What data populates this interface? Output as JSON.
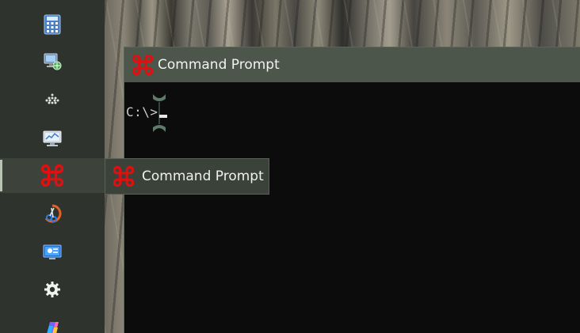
{
  "taskbar": {
    "items": [
      {
        "icon": "calculator-icon"
      },
      {
        "icon": "network-computer-icon"
      },
      {
        "icon": "dots-grid-icon"
      },
      {
        "icon": "performance-monitor-icon"
      },
      {
        "icon": "command-prompt-icon",
        "active": true
      },
      {
        "icon": "snipping-tool-icon"
      },
      {
        "icon": "remote-desktop-icon"
      },
      {
        "icon": "gear-icon"
      },
      {
        "icon": "copilot-icon"
      }
    ]
  },
  "window": {
    "title": "Command Prompt",
    "prompt": "C:\\>"
  },
  "tooltip": {
    "label": "Command Prompt"
  },
  "colors": {
    "cmd_icon_red": "#e01010",
    "console_bg": "#0c0c0c",
    "titlebar_bg": "#4d564b",
    "taskbar_bg": "#2e332d"
  }
}
